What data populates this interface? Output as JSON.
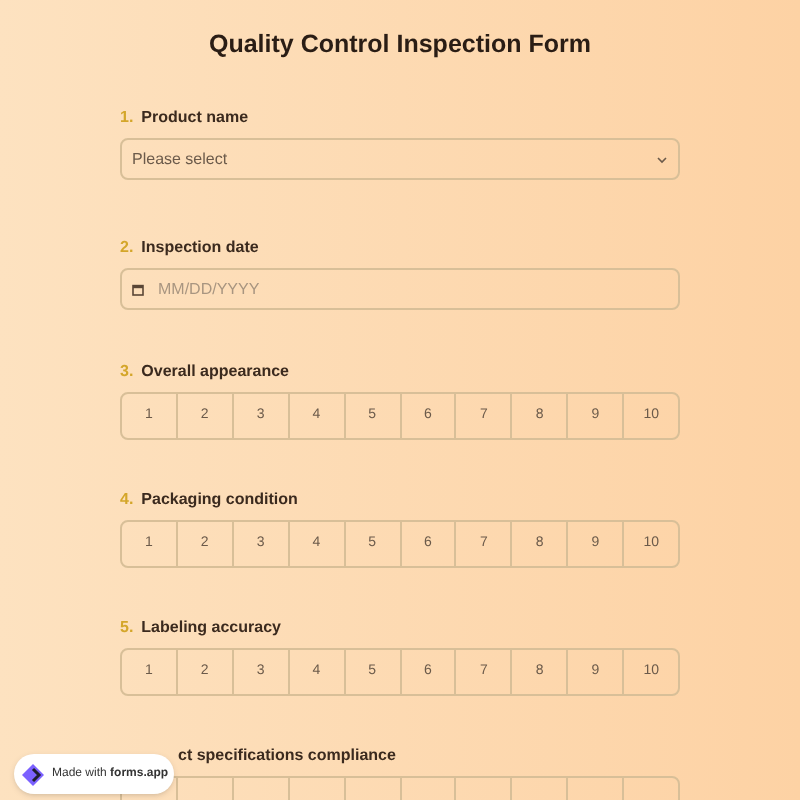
{
  "title": "Quality Control Inspection Form",
  "questions": [
    {
      "kind": "select",
      "number": "1.",
      "label": "Product name",
      "placeholder": "Please select"
    },
    {
      "kind": "date",
      "number": "2.",
      "label": "Inspection date",
      "placeholder": "MM/DD/YYYY"
    },
    {
      "kind": "scale",
      "number": "3.",
      "label": "Overall appearance",
      "options": [
        "1",
        "2",
        "3",
        "4",
        "5",
        "6",
        "7",
        "8",
        "9",
        "10"
      ]
    },
    {
      "kind": "scale",
      "number": "4.",
      "label": "Packaging condition",
      "options": [
        "1",
        "2",
        "3",
        "4",
        "5",
        "6",
        "7",
        "8",
        "9",
        "10"
      ]
    },
    {
      "kind": "scale",
      "number": "5.",
      "label": "Labeling accuracy",
      "options": [
        "1",
        "2",
        "3",
        "4",
        "5",
        "6",
        "7",
        "8",
        "9",
        "10"
      ]
    },
    {
      "kind": "scale-cut",
      "label": "ct specifications compliance"
    }
  ],
  "badge": {
    "prefix": "Made with",
    "brand": "forms.app"
  }
}
